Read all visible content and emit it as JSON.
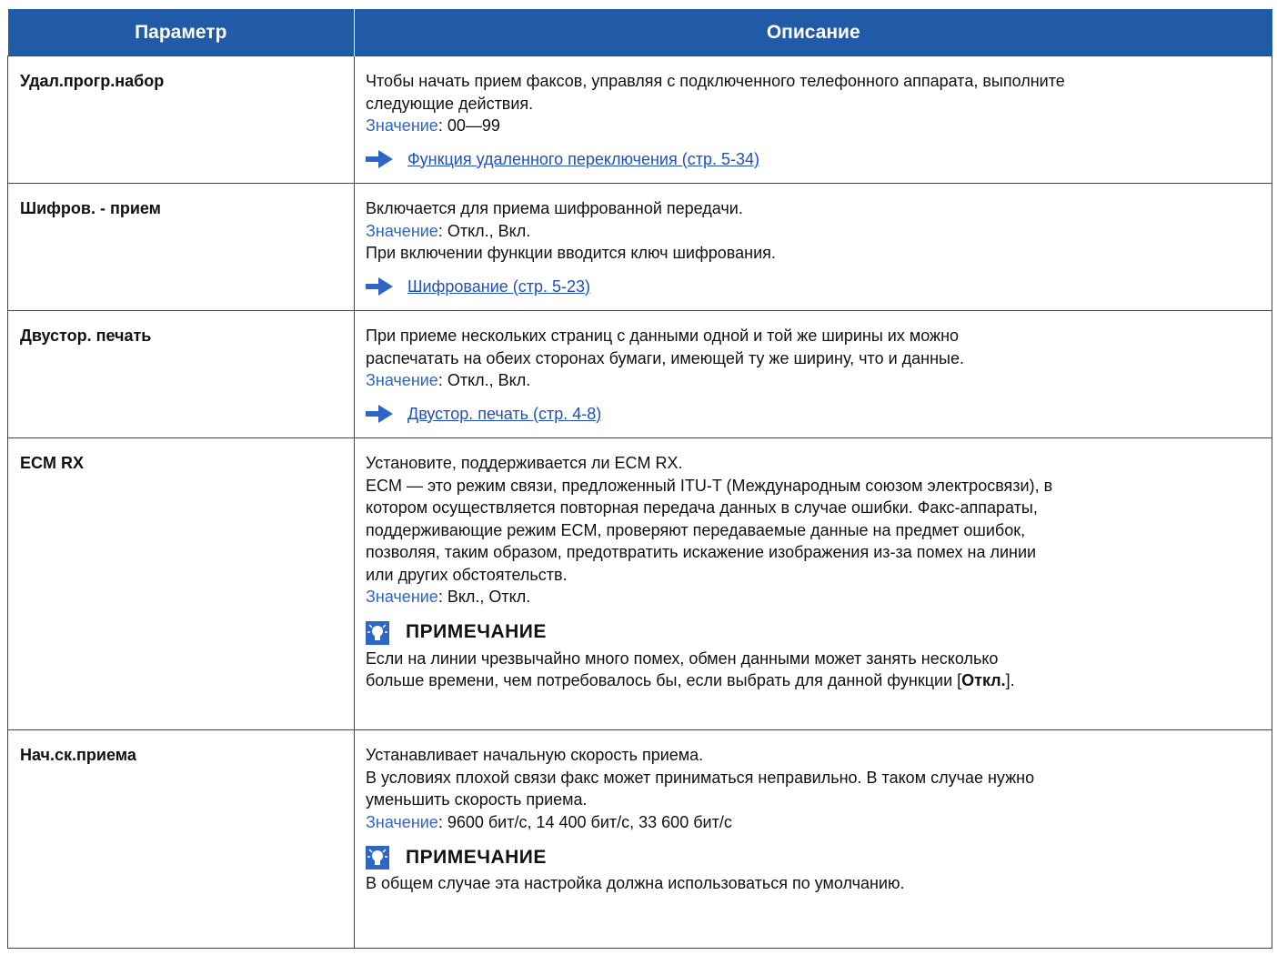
{
  "table": {
    "headers": [
      "Параметр",
      "Описание"
    ],
    "rows": [
      {
        "param": "Удал.прогр.набор",
        "lines": [
          "Чтобы начать прием факсов, управляя с подключенного телефонного аппарата, выполните",
          "следующие действия."
        ],
        "value_label": "Значение",
        "value_text": ": 00—99",
        "link": "Функция удаленного переключения (стр. 5-34)"
      },
      {
        "param": "Шифров. - прием",
        "lines_before": [
          "Включается для приема шифрованной передачи."
        ],
        "value_label": "Значение",
        "value_text": ": Откл., Вкл.",
        "lines_after": [
          "При включении функции вводится ключ шифрования."
        ],
        "link": "Шифрование (стр. 5-23)"
      },
      {
        "param": "Двустор. печать",
        "lines": [
          "При приеме нескольких страниц с данными одной и той же ширины их можно",
          "распечатать на обеих сторонах бумаги, имеющей ту же ширину, что и данные."
        ],
        "value_label": "Значение",
        "value_text": ": Откл., Вкл.",
        "link": "Двустор. печать (стр. 4-8)"
      },
      {
        "param": "ECM RX",
        "lines": [
          "Установите, поддерживается ли ECM RX.",
          "ECM — это режим связи, предложенный ITU-T (Международным союзом электросвязи), в",
          "котором осуществляется повторная передача данных в случае ошибки. Факс-аппараты,",
          "поддерживающие режим ECM, проверяют передаваемые данные на предмет ошибок,",
          "позволяя, таким образом, предотвратить искажение изображения из-за помех на линии",
          "или других обстоятельств."
        ],
        "value_label": "Значение",
        "value_text": ": Вкл., Откл.",
        "note_title": "ПРИМЕЧАНИЕ",
        "note_line1": "Если на линии чрезвычайно много помех, обмен данными может занять несколько",
        "note_line2_pre": "больше времени, чем потребовалось бы, если выбрать для данной функции [",
        "note_line2_bold": "Откл.",
        "note_line2_post": "]."
      },
      {
        "param": "Нач.ск.приема",
        "lines": [
          "Устанавливает начальную скорость приема.",
          "В условиях плохой связи факс может приниматься неправильно. В таком случае нужно",
          "уменьшить скорость приема."
        ],
        "value_label": "Значение",
        "value_text": ": 9600 бит/с, 14 400 бит/с, 33 600 бит/с",
        "note_title": "ПРИМЕЧАНИЕ",
        "note_line1": "В общем случае эта настройка должна использоваться по умолчанию."
      }
    ]
  },
  "colors": {
    "header_bg": "#215ba8",
    "value_label": "#2f65c4",
    "link": "#1f4fc0",
    "arrow": "#2f65c4"
  }
}
